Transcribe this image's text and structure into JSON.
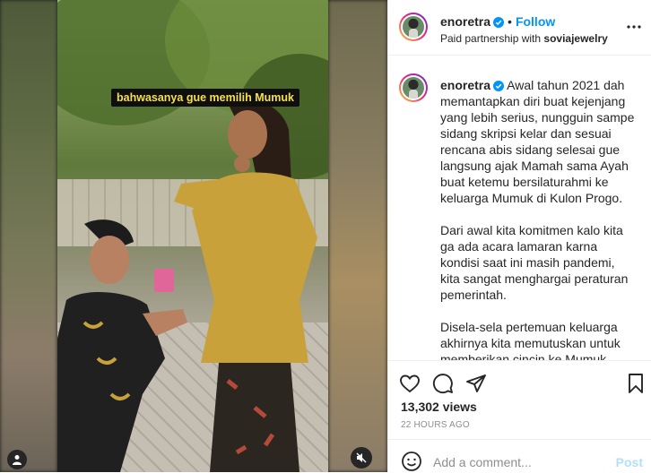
{
  "media": {
    "caption_overlay": "bahwasanya gue memilih Mumuk",
    "mute_icon": "speaker-muted-icon",
    "user_tag_icon": "person-icon"
  },
  "header": {
    "username": "enoretra",
    "follow_label": "Follow",
    "separator": "•",
    "partnership_prefix": "Paid partnership with",
    "partner": "soviajewelry"
  },
  "caption": {
    "username": "enoretra",
    "paragraphs": [
      "Awal tahun 2021 dah memantapkan diri buat kejenjang yang lebih serius, nungguin sampe sidang skripsi kelar dan sesuai rencana abis sidang selesai gue langsung ajak Mamah sama Ayah buat ketemu bersilaturahmi ke keluarga Mumuk di Kulon Progo.",
      "Dari awal kita komitmen kalo kita ga ada acara lamaran karna kondisi saat ini masih pandemi, kita sangat menghargai peraturan pemerintah.",
      "Disela-sela pertemuan keluarga akhirnya kita memutuskan untuk memberikan cincin ke Mumuk sebagai simbolis keseriusan gue untuk ke jenjang pernikahan."
    ]
  },
  "stats": {
    "views": "13,302 views",
    "timestamp": "22 HOURS AGO"
  },
  "comment_box": {
    "placeholder": "Add a comment...",
    "post_label": "Post"
  },
  "colors": {
    "accent": "#0095f6",
    "post_disabled": "#b2dffc",
    "overlay_text": "#f6e04a",
    "muted_text": "#8e8e8e"
  }
}
